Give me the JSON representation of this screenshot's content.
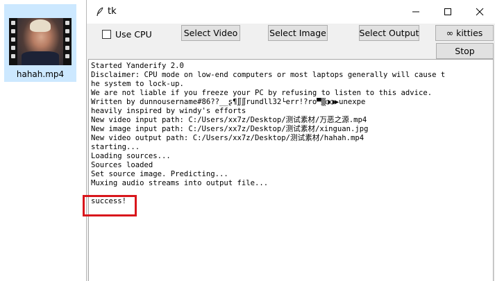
{
  "desktop": {
    "file_name": "hahah.mp4",
    "file_icon": "video-file-icon"
  },
  "window": {
    "title": "tk",
    "app_icon": "feather-icon",
    "controls": [
      "minimize-icon",
      "maximize-icon",
      "close-icon"
    ]
  },
  "toolbar": {
    "use_cpu_label": "Use CPU",
    "use_cpu_checked": false,
    "select_video_label": "Select Video",
    "select_image_label": "Select Image",
    "select_output_label": "Select Output",
    "kitties_label": "∞ kitties",
    "stop_label": "Stop"
  },
  "console": {
    "lines": [
      "Started Yanderify 2.0",
      "Disclaimer: CPU mode on low-end computers or most laptops generally will cause t",
      "he system to lock-up.",
      "We are not liable if you freeze your PC by refusing to listen to this advice.",
      "Written by dunnousername#86??__ʂ¶∬∬rundll32└err!?ro▀▒◑◑▶unexpe",
      "heavily inspired by windy's efforts",
      "New video input path: C:/Users/xx7z/Desktop/测试素材/万恶之源.mp4",
      "New image input path: C:/Users/xx7z/Desktop/测试素材/xinguan.jpg",
      "New video output path: C:/Users/xx7z/Desktop/测试素材/hahah.mp4",
      "starting...",
      "Loading sources...",
      "Sources loaded",
      "Set source image. Predicting...",
      "Muxing audio streams into output file...",
      "",
      "success!"
    ]
  },
  "colors": {
    "highlight": "#d9161c",
    "file_selection": "#cce8ff"
  }
}
